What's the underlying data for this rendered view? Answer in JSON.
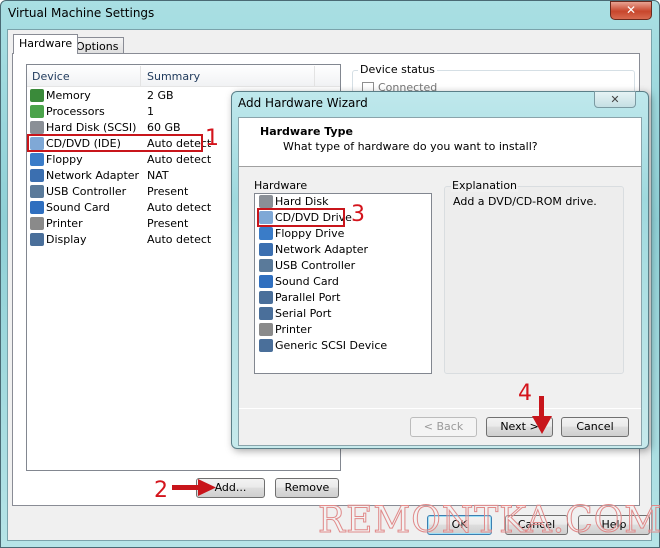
{
  "window": {
    "title": "Virtual Machine Settings",
    "close": "✕"
  },
  "tabs": [
    {
      "label": "Hardware"
    },
    {
      "label": "Options"
    }
  ],
  "device_list": {
    "headers": [
      "Device",
      "Summary"
    ],
    "rows": [
      {
        "name": "Memory",
        "summary": "2 GB",
        "icon": "memory-icon",
        "color": "#3a8a3a"
      },
      {
        "name": "Processors",
        "summary": "1",
        "icon": "processor-icon",
        "color": "#4aa34a"
      },
      {
        "name": "Hard Disk (SCSI)",
        "summary": "60 GB",
        "icon": "hard-disk-icon",
        "color": "#8a8f96"
      },
      {
        "name": "CD/DVD (IDE)",
        "summary": "Auto detect",
        "icon": "cd-dvd-icon",
        "color": "#7fa8d6"
      },
      {
        "name": "Floppy",
        "summary": "Auto detect",
        "icon": "floppy-icon",
        "color": "#3a7cc8"
      },
      {
        "name": "Network Adapter",
        "summary": "NAT",
        "icon": "network-icon",
        "color": "#3b6fb0"
      },
      {
        "name": "USB Controller",
        "summary": "Present",
        "icon": "usb-icon",
        "color": "#5a7a9a"
      },
      {
        "name": "Sound Card",
        "summary": "Auto detect",
        "icon": "sound-icon",
        "color": "#2f6fbf"
      },
      {
        "name": "Printer",
        "summary": "Present",
        "icon": "printer-icon",
        "color": "#8a8a8a"
      },
      {
        "name": "Display",
        "summary": "Auto detect",
        "icon": "display-icon",
        "color": "#4a6f9a"
      }
    ]
  },
  "device_status": {
    "label": "Device status",
    "connected": "Connected"
  },
  "buttons": {
    "add": "Add...",
    "remove": "Remove",
    "ok": "OK",
    "cancel": "Cancel",
    "help": "Help"
  },
  "wizard": {
    "title": "Add Hardware Wizard",
    "close": "✕",
    "heading": "Hardware Type",
    "subheading": "What type of hardware do you want to install?",
    "hardware_label": "Hardware",
    "items": [
      {
        "name": "Hard Disk",
        "icon": "hard-disk-icon",
        "color": "#8a8f96"
      },
      {
        "name": "CD/DVD Drive",
        "icon": "cd-dvd-icon",
        "color": "#7fa8d6"
      },
      {
        "name": "Floppy Drive",
        "icon": "floppy-icon",
        "color": "#3a7cc8"
      },
      {
        "name": "Network Adapter",
        "icon": "network-icon",
        "color": "#3b6fb0"
      },
      {
        "name": "USB Controller",
        "icon": "usb-icon",
        "color": "#5a7a9a"
      },
      {
        "name": "Sound Card",
        "icon": "sound-icon",
        "color": "#2f6fbf"
      },
      {
        "name": "Parallel Port",
        "icon": "parallel-port-icon",
        "color": "#4a6f9a"
      },
      {
        "name": "Serial Port",
        "icon": "serial-port-icon",
        "color": "#4a6f9a"
      },
      {
        "name": "Printer",
        "icon": "printer-icon",
        "color": "#8a8a8a"
      },
      {
        "name": "Generic SCSI Device",
        "icon": "scsi-icon",
        "color": "#4a6f9a"
      }
    ],
    "explanation_label": "Explanation",
    "explanation": "Add a DVD/CD-ROM drive.",
    "back": "< Back",
    "next": "Next >",
    "cancel": "Cancel"
  },
  "annotations": {
    "step1": "1",
    "step2": "2",
    "step3": "3",
    "step4": "4",
    "color": "#d4141c"
  },
  "watermark": "REMONTKA.COM"
}
